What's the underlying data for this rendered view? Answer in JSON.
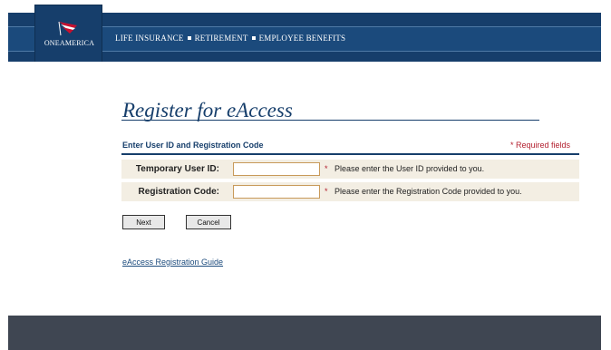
{
  "header": {
    "logo_text": "ONEAMERICA",
    "tagline_items": [
      "LIFE INSURANCE",
      "RETIREMENT",
      "EMPLOYEE BENEFITS"
    ],
    "colors": {
      "navy": "#163e6b",
      "accent_red": "#b3202f",
      "footer": "#3f4652"
    }
  },
  "main": {
    "title": "Register for eAccess",
    "section_title": "Enter User ID and Registration Code",
    "required_note": "* Required fields",
    "fields": [
      {
        "label": "Temporary User ID:",
        "value": "",
        "required_star": "*",
        "hint": "Please enter the User ID provided to you."
      },
      {
        "label": "Registration Code:",
        "value": "",
        "required_star": "*",
        "hint": "Please enter the Registration Code provided to you."
      }
    ],
    "buttons": {
      "next": "Next",
      "cancel": "Cancel"
    },
    "guide_link": "eAccess Registration Guide"
  }
}
